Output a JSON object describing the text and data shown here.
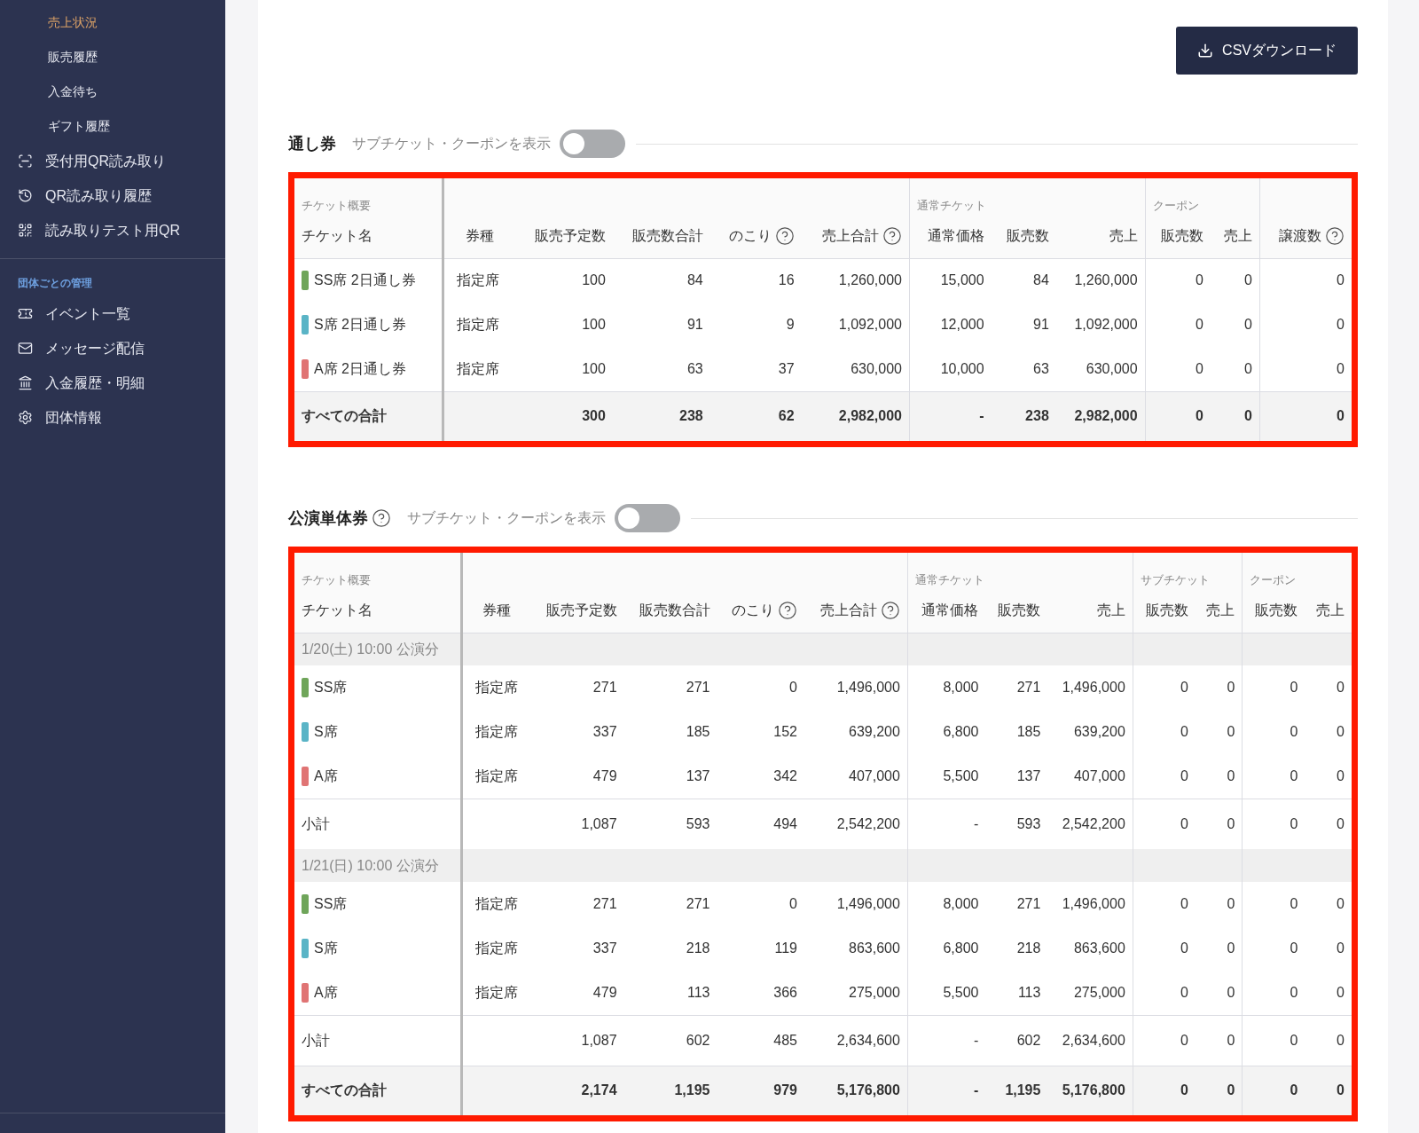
{
  "sidebar": {
    "items": [
      {
        "label": "売上状況",
        "kind": "sub",
        "selected": true
      },
      {
        "label": "販売履歴",
        "kind": "sub",
        "selected": false
      },
      {
        "label": "入金待ち",
        "kind": "sub",
        "selected": false
      },
      {
        "label": "ギフト履歴",
        "kind": "sub",
        "selected": false
      },
      {
        "label": "受付用QR読み取り",
        "kind": "scan",
        "selected": false
      },
      {
        "label": "QR読み取り履歴",
        "kind": "history",
        "selected": false
      },
      {
        "label": "読み取りテスト用QR",
        "kind": "qr",
        "selected": false
      }
    ],
    "section_title": "団体ごとの管理",
    "section_items": [
      {
        "label": "イベント一覧",
        "kind": "ticket",
        "selected": false
      },
      {
        "label": "メッセージ配信",
        "kind": "mail",
        "selected": false
      },
      {
        "label": "入金履歴・明細",
        "kind": "bank",
        "selected": false
      },
      {
        "label": "団体情報",
        "kind": "gear",
        "selected": false
      }
    ]
  },
  "csv_button": "CSVダウンロード",
  "sections": [
    {
      "title": "通し券",
      "help": false,
      "toggle_label": "サブチケット・クーポンを表示",
      "toggle_on": false,
      "groups": [
        {
          "label": "チケット概要",
          "columns": [
            {
              "label": "チケット名",
              "help": false
            }
          ]
        },
        {
          "columns": [
            {
              "label": "券種",
              "help": false
            },
            {
              "label": "販売予定数",
              "help": false
            },
            {
              "label": "販売数合計",
              "help": false
            },
            {
              "label": "のこり",
              "help": true
            },
            {
              "label": "売上合計",
              "help": true
            }
          ]
        },
        {
          "label": "通常チケット",
          "columns": [
            {
              "label": "通常価格",
              "help": false
            },
            {
              "label": "販売数",
              "help": false
            },
            {
              "label": "売上",
              "help": false
            }
          ]
        },
        {
          "label": "クーポン",
          "columns": [
            {
              "label": "販売数",
              "help": false
            },
            {
              "label": "売上",
              "help": false
            }
          ]
        },
        {
          "columns": [
            {
              "label": "譲渡数",
              "help": true
            }
          ]
        }
      ],
      "rows": [
        {
          "kind": "ticket",
          "color": "#6fa55a",
          "cells": [
            "SS席 2日通し券",
            "指定席",
            "100",
            "84",
            "16",
            "1,260,000",
            "15,000",
            "84",
            "1,260,000",
            "0",
            "0",
            "0"
          ]
        },
        {
          "kind": "ticket",
          "color": "#5ab4c6",
          "cells": [
            "S席 2日通し券",
            "指定席",
            "100",
            "91",
            "9",
            "1,092,000",
            "12,000",
            "91",
            "1,092,000",
            "0",
            "0",
            "0"
          ]
        },
        {
          "kind": "ticket",
          "color": "#e07474",
          "cells": [
            "A席 2日通し券",
            "指定席",
            "100",
            "63",
            "37",
            "630,000",
            "10,000",
            "63",
            "630,000",
            "0",
            "0",
            "0"
          ]
        },
        {
          "kind": "total",
          "cells": [
            "すべての合計",
            "",
            "300",
            "238",
            "62",
            "2,982,000",
            "-",
            "238",
            "2,982,000",
            "0",
            "0",
            "0"
          ]
        }
      ]
    },
    {
      "title": "公演単体券",
      "help": true,
      "toggle_label": "サブチケット・クーポンを表示",
      "toggle_on": false,
      "groups": [
        {
          "label": "チケット概要",
          "columns": [
            {
              "label": "チケット名",
              "help": false
            }
          ]
        },
        {
          "columns": [
            {
              "label": "券種",
              "help": false
            },
            {
              "label": "販売予定数",
              "help": false
            },
            {
              "label": "販売数合計",
              "help": false
            },
            {
              "label": "のこり",
              "help": true
            },
            {
              "label": "売上合計",
              "help": true
            }
          ]
        },
        {
          "label": "通常チケット",
          "columns": [
            {
              "label": "通常価格",
              "help": false
            },
            {
              "label": "販売数",
              "help": false
            },
            {
              "label": "売上",
              "help": false
            }
          ]
        },
        {
          "label": "サブチケット",
          "columns": [
            {
              "label": "販売数",
              "help": false
            },
            {
              "label": "売上",
              "help": false
            }
          ]
        },
        {
          "label": "クーポン",
          "columns": [
            {
              "label": "販売数",
              "help": false
            },
            {
              "label": "売上",
              "help": false
            }
          ]
        }
      ],
      "rows": [
        {
          "kind": "date",
          "cells": [
            "1/20(土) 10:00 公演分"
          ]
        },
        {
          "kind": "ticket",
          "color": "#6fa55a",
          "cells": [
            "SS席",
            "指定席",
            "271",
            "271",
            "0",
            "1,496,000",
            "8,000",
            "271",
            "1,496,000",
            "0",
            "0",
            "0",
            "0"
          ]
        },
        {
          "kind": "ticket",
          "color": "#5ab4c6",
          "cells": [
            "S席",
            "指定席",
            "337",
            "185",
            "152",
            "639,200",
            "6,800",
            "185",
            "639,200",
            "0",
            "0",
            "0",
            "0"
          ]
        },
        {
          "kind": "ticket",
          "color": "#e07474",
          "cells": [
            "A席",
            "指定席",
            "479",
            "137",
            "342",
            "407,000",
            "5,500",
            "137",
            "407,000",
            "0",
            "0",
            "0",
            "0"
          ]
        },
        {
          "kind": "subtotal",
          "cells": [
            "小計",
            "",
            "1,087",
            "593",
            "494",
            "2,542,200",
            "-",
            "593",
            "2,542,200",
            "0",
            "0",
            "0",
            "0"
          ]
        },
        {
          "kind": "date",
          "cells": [
            "1/21(日) 10:00 公演分"
          ]
        },
        {
          "kind": "ticket",
          "color": "#6fa55a",
          "cells": [
            "SS席",
            "指定席",
            "271",
            "271",
            "0",
            "1,496,000",
            "8,000",
            "271",
            "1,496,000",
            "0",
            "0",
            "0",
            "0"
          ]
        },
        {
          "kind": "ticket",
          "color": "#5ab4c6",
          "cells": [
            "S席",
            "指定席",
            "337",
            "218",
            "119",
            "863,600",
            "6,800",
            "218",
            "863,600",
            "0",
            "0",
            "0",
            "0"
          ]
        },
        {
          "kind": "ticket",
          "color": "#e07474",
          "cells": [
            "A席",
            "指定席",
            "479",
            "113",
            "366",
            "275,000",
            "5,500",
            "113",
            "275,000",
            "0",
            "0",
            "0",
            "0"
          ]
        },
        {
          "kind": "subtotal",
          "cells": [
            "小計",
            "",
            "1,087",
            "602",
            "485",
            "2,634,600",
            "-",
            "602",
            "2,634,600",
            "0",
            "0",
            "0",
            "0"
          ]
        },
        {
          "kind": "total",
          "cells": [
            "すべての合計",
            "",
            "2,174",
            "1,195",
            "979",
            "5,176,800",
            "-",
            "1,195",
            "5,176,800",
            "0",
            "0",
            "0",
            "0"
          ]
        }
      ]
    }
  ]
}
